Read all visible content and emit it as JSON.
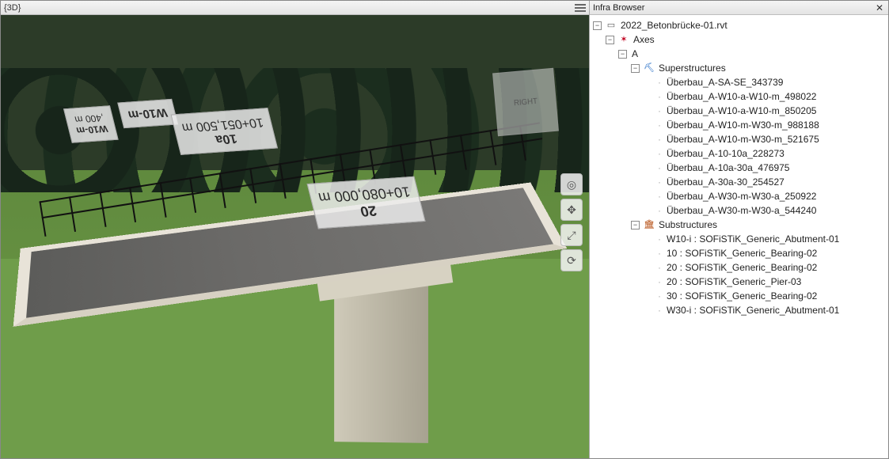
{
  "viewport": {
    "title": "{3D}",
    "view_cube_face": "RIGHT",
    "scene_labels": {
      "l1": {
        "line1": "W10-m",
        "line2": ",400 m"
      },
      "l2": {
        "line1": "W10-m",
        "line2": ""
      },
      "l3": {
        "line1": "10a",
        "line2": "10+051,500 m"
      },
      "l4": {
        "line1": "20",
        "line2": "10+080,000 m"
      }
    },
    "controls_tooltips": {
      "steering": "Steering Wheels",
      "pan": "Pan",
      "zoom": "Zoom",
      "orbit": "Orbit"
    }
  },
  "browser": {
    "title": "Infra Browser",
    "root": "2022_Betonbrücke-01.rvt",
    "axes_label": "Axes",
    "axis_A": "A",
    "super_label": "Superstructures",
    "super_items": [
      "Überbau_A-SA-SE_343739",
      "Überbau_A-W10-a-W10-m_498022",
      "Überbau_A-W10-a-W10-m_850205",
      "Überbau_A-W10-m-W30-m_988188",
      "Überbau_A-W10-m-W30-m_521675",
      "Überbau_A-10-10a_228273",
      "Überbau_A-10a-30a_476975",
      "Überbau_A-30a-30_254527",
      "Überbau_A-W30-m-W30-a_250922",
      "Überbau_A-W30-m-W30-a_544240"
    ],
    "sub_label": "Substructures",
    "sub_items": [
      "W10-i : SOFiSTiK_Generic_Abutment-01",
      "10 : SOFiSTiK_Generic_Bearing-02",
      "20 : SOFiSTiK_Generic_Bearing-02",
      "20 : SOFiSTiK_Generic_Pier-03",
      "30 : SOFiSTiK_Generic_Bearing-02",
      "W30-i : SOFiSTiK_Generic_Abutment-01"
    ]
  }
}
